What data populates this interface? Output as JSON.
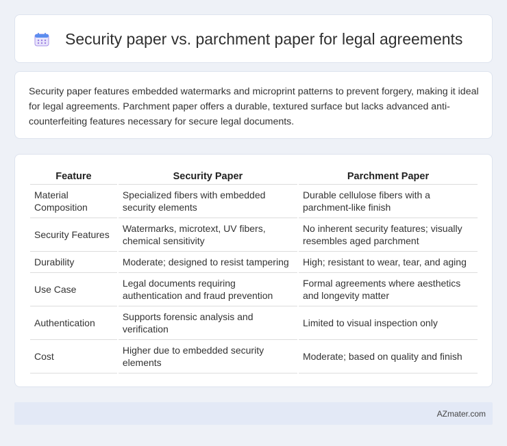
{
  "header": {
    "title": "Security paper vs. parchment paper for legal agreements",
    "icon": "calendar-icon"
  },
  "summary": {
    "text": "Security paper features embedded watermarks and microprint patterns to prevent forgery, making it ideal for legal agreements. Parchment paper offers a durable, textured surface but lacks advanced anti-counterfeiting features necessary for secure legal documents."
  },
  "table": {
    "headers": [
      "Feature",
      "Security Paper",
      "Parchment Paper"
    ],
    "rows": [
      [
        "Material Composition",
        "Specialized fibers with embedded security elements",
        "Durable cellulose fibers with a parchment-like finish"
      ],
      [
        "Security Features",
        "Watermarks, microtext, UV fibers, chemical sensitivity",
        "No inherent security features; visually resembles aged parchment"
      ],
      [
        "Durability",
        "Moderate; designed to resist tampering",
        "High; resistant to wear, tear, and aging"
      ],
      [
        "Use Case",
        "Legal documents requiring authentication and fraud prevention",
        "Formal agreements where aesthetics and longevity matter"
      ],
      [
        "Authentication",
        "Supports forensic analysis and verification",
        "Limited to visual inspection only"
      ],
      [
        "Cost",
        "Higher due to embedded security elements",
        "Moderate; based on quality and finish"
      ]
    ]
  },
  "footer": {
    "text": "AZmater.com"
  },
  "colors": {
    "background": "#eef1f7",
    "footer_bg": "#e3e9f6",
    "icon_blue": "#4a86e8",
    "icon_purple": "#9b7fe0"
  }
}
